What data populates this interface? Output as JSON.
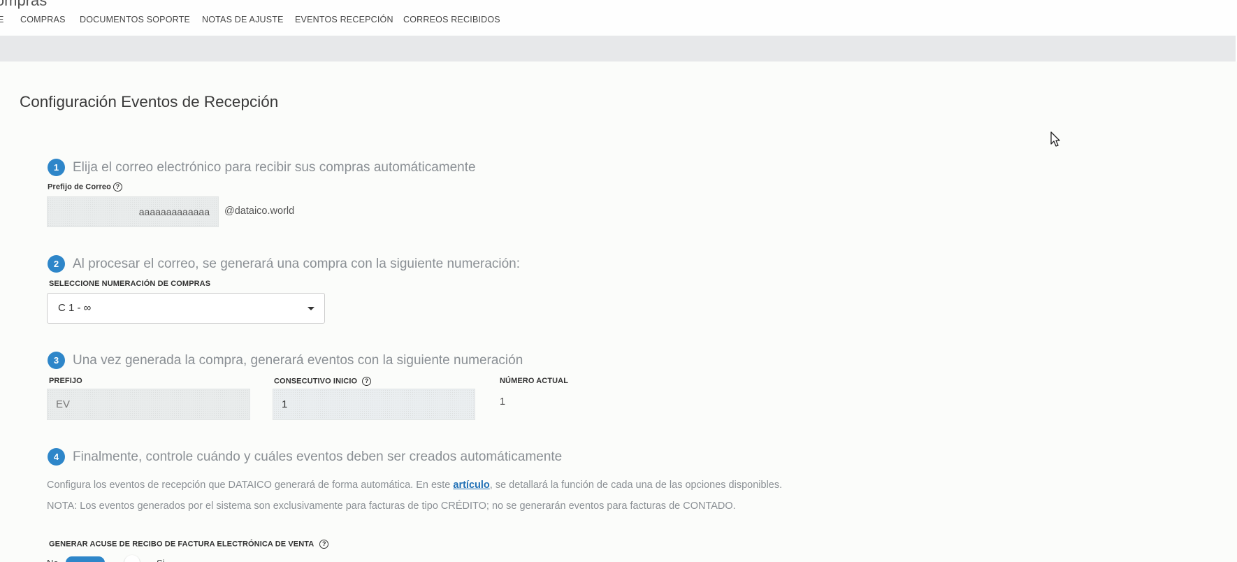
{
  "header": {
    "app_title": "Compras",
    "nav": [
      "E",
      "COMPRAS",
      "DOCUMENTOS SOPORTE",
      "NOTAS DE AJUSTE",
      "EVENTOS RECEPCIÓN",
      "CORREOS RECIBIDOS"
    ]
  },
  "page": {
    "title": "Configuración Eventos de Recepción"
  },
  "step1": {
    "number": "1",
    "text": "Elija el correo electrónico para recibir sus compras automáticamente",
    "label": "Prefijo de Correo",
    "help": "?",
    "value": "aaaaaaaaaaaaa",
    "domain": "@dataico.world"
  },
  "step2": {
    "number": "2",
    "text": "Al procesar el correo, se generará una compra con la siguiente numeración:",
    "label": "SELECCIONE NUMERACIÓN DE COMPRAS",
    "selected": "C 1 - ∞"
  },
  "step3": {
    "number": "3",
    "text": "Una vez generada la compra, generará eventos con la siguiente numeración",
    "prefijo_label": "PREFIJO",
    "prefijo_value": "EV",
    "consecutivo_label": "CONSECUTIVO INICIO",
    "help": "?",
    "consecutivo_value": "1",
    "numero_actual_label": "NÚMERO ACTUAL",
    "numero_actual_value": "1"
  },
  "step4": {
    "number": "4",
    "text": "Finalmente, controle cuándo y cuáles eventos deben ser creados automáticamente",
    "desc_before": "Configura los eventos de recepción que DATAICO generará de forma automática. En este ",
    "desc_link": "artículo",
    "desc_after": ", se detallará la función de cada una de las opciones disponibles.",
    "note": "NOTA: Los eventos generados por el sistema son exclusivamente para facturas de tipo CRÉDITO; no se generarán eventos para facturas de CONTADO.",
    "toggle_label": "GENERAR ACUSE DE RECIBO DE FACTURA ELECTRÓNICA DE VENTA",
    "help": "?",
    "toggle_off": "No",
    "toggle_on": "Si"
  },
  "colors": {
    "accent": "#2e86c9",
    "link": "#1f6fb5",
    "band": "#e7e8ea"
  }
}
